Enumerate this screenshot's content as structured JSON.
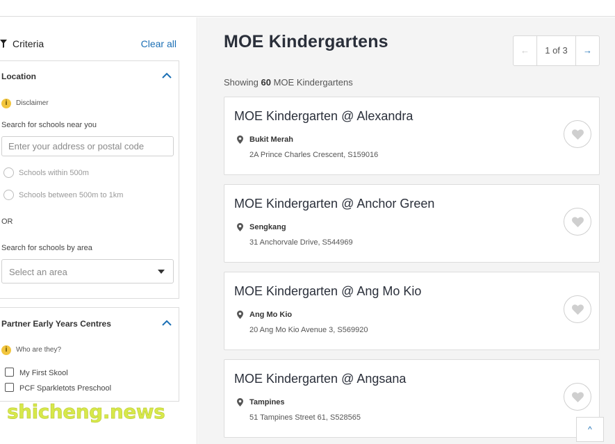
{
  "sidebar": {
    "criteria_label": "Criteria",
    "clear_all": "Clear all",
    "location": {
      "title": "Location",
      "disclaimer": "Disclaimer",
      "search_near_label": "Search for schools near you",
      "address_placeholder": "Enter your address or postal code",
      "radio_options": [
        "Schools within 500m",
        "Schools between 500m to 1km"
      ],
      "or_label": "OR",
      "search_area_label": "Search for schools by area",
      "area_select_value": "Select an area"
    },
    "partner": {
      "title": "Partner Early Years Centres",
      "who_label": "Who are they?",
      "options": [
        "My First Skool",
        "PCF Sparkletots Preschool"
      ]
    }
  },
  "main": {
    "title": "MOE Kindergartens",
    "pager": {
      "prev": "←",
      "text": "1 of 3",
      "next": "→"
    },
    "showing_prefix": "Showing",
    "showing_count": "60",
    "showing_suffix": "MOE Kindergartens",
    "cards": [
      {
        "name": "MOE Kindergarten @ Alexandra",
        "area": "Bukit Merah",
        "address": "2A Prince Charles Crescent, S159016"
      },
      {
        "name": "MOE Kindergarten @ Anchor Green",
        "area": "Sengkang",
        "address": "31 Anchorvale Drive, S544969"
      },
      {
        "name": "MOE Kindergarten @ Ang Mo Kio",
        "area": "Ang Mo Kio",
        "address": "20 Ang Mo Kio Avenue 3, S569920"
      },
      {
        "name": "MOE Kindergarten @ Angsana",
        "area": "Tampines",
        "address": "51 Tampines Street 61, S528565"
      }
    ],
    "scroll_top": "^"
  },
  "watermark": "shicheng.news",
  "colors": {
    "accent": "#1b6fb5",
    "info_badge": "#f2c53d",
    "page_bg": "#f4f4f4",
    "watermark": "#d7e84a"
  },
  "icons": {
    "filter": "filter-icon",
    "chevron_up": "chevron-up-icon",
    "info": "info-icon",
    "pin": "location-pin-icon",
    "heart": "heart-icon",
    "caret": "caret-down-icon"
  }
}
